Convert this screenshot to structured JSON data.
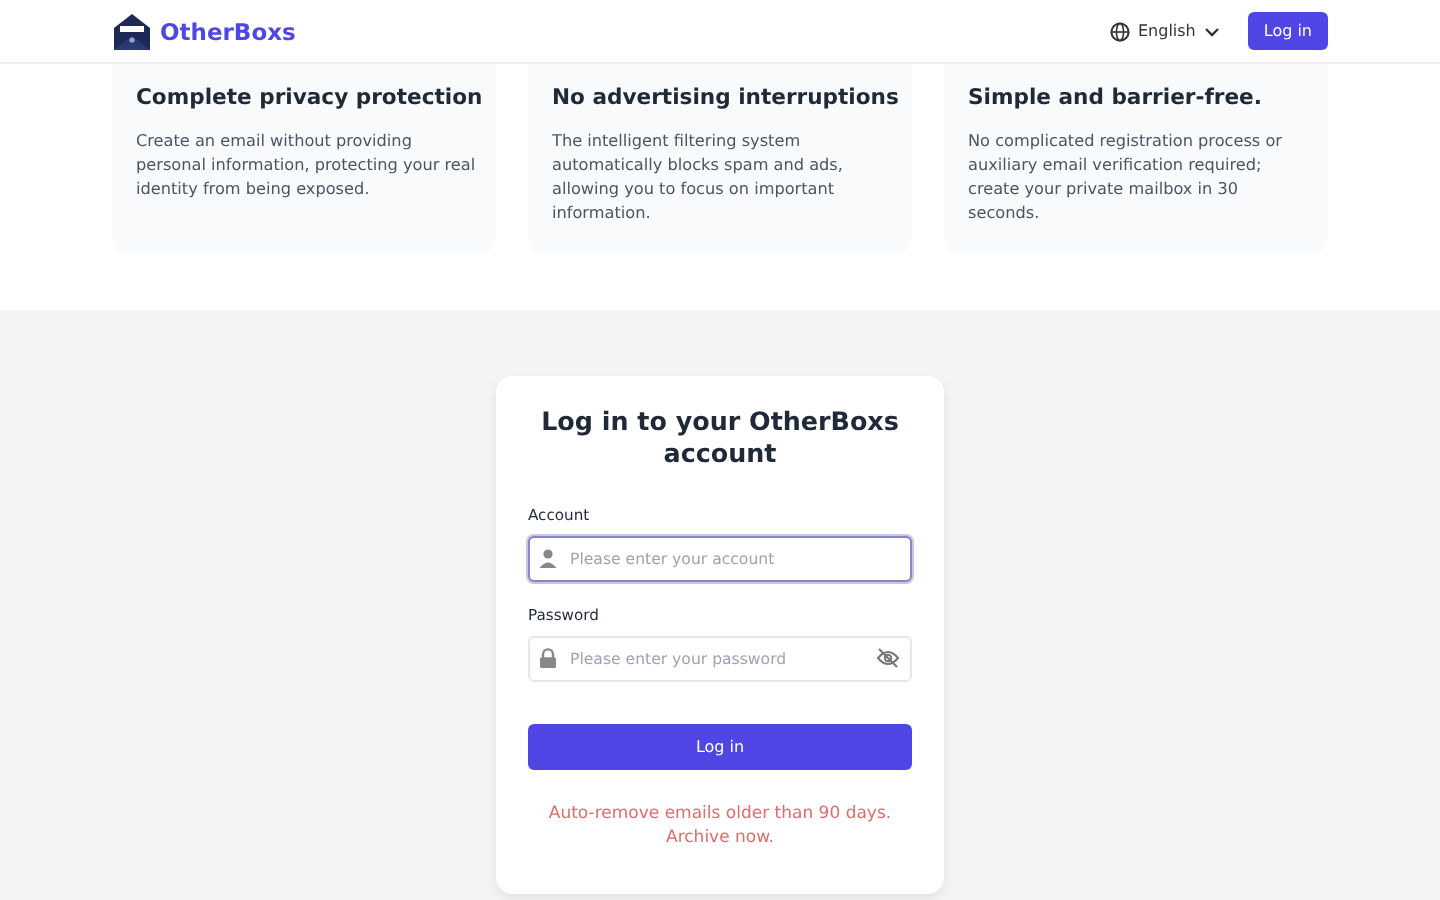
{
  "header": {
    "brand": "OtherBoxs",
    "language": "English",
    "login_button": "Log in"
  },
  "features": [
    {
      "title": "Complete privacy protection",
      "text": "Create an email without providing personal information, protecting your real identity from being exposed."
    },
    {
      "title": "No advertising interruptions",
      "text": "The intelligent filtering system automatically blocks spam and ads, allowing you to focus on important information."
    },
    {
      "title": "Simple and barrier-free.",
      "text": "No complicated registration process or auxiliary email verification required; create your private mailbox in 30 seconds."
    }
  ],
  "login": {
    "title": "Log in to your OtherBoxs account",
    "fields": [
      {
        "kind": "account",
        "label": "Account",
        "placeholder": "Please enter your account",
        "focused": true
      },
      {
        "kind": "password",
        "label": "Password",
        "placeholder": "Please enter your password",
        "focused": false
      }
    ],
    "submit": "Log in",
    "notice": "Auto-remove emails older than 90 days. Archive now."
  }
}
